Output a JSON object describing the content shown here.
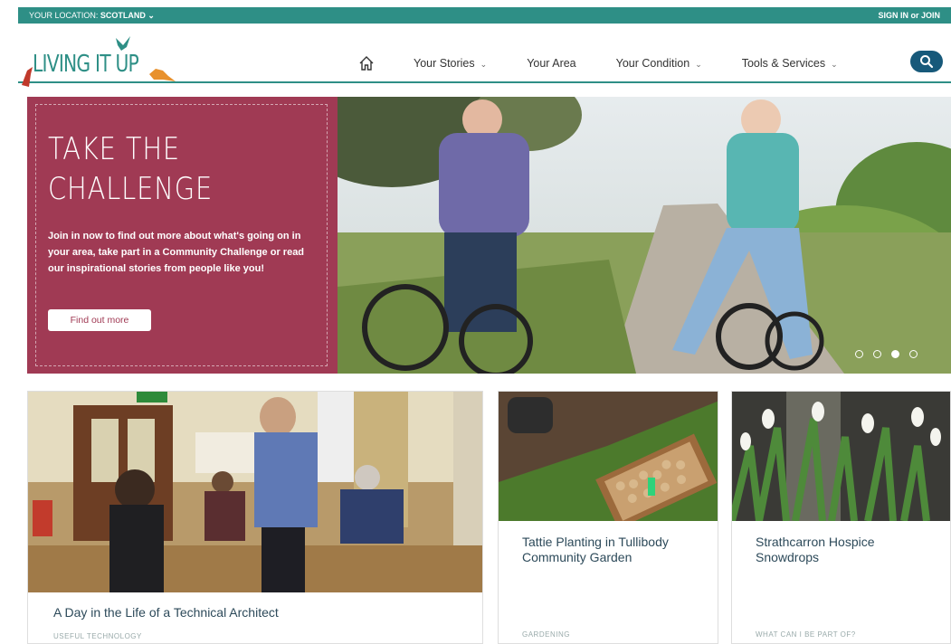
{
  "topbar": {
    "location_label": "YOUR LOCATION:",
    "location_value": "SCOTLAND",
    "location_chevron": "⌄",
    "signin": "SIGN IN or JOIN"
  },
  "header": {
    "logo_text": "LIVING IT UP",
    "nav": [
      {
        "label": "Your Stories",
        "has_dropdown": true
      },
      {
        "label": "Your Area",
        "has_dropdown": false
      },
      {
        "label": "Your Condition",
        "has_dropdown": true
      },
      {
        "label": "Tools & Services",
        "has_dropdown": true
      }
    ],
    "dropdown_glyph": "⌄"
  },
  "hero": {
    "title_line1": "TAKE THE",
    "title_line2": "CHALLENGE",
    "body": "Join in now to find out more about what's going on in your area, take part in a Community Challenge or read our inspirational stories from people like you!",
    "button_label": "Find out more",
    "slides": 4,
    "active_slide": 3
  },
  "cards": [
    {
      "title": "A Day in the Life of a Technical Architect",
      "category": "USEFUL TECHNOLOGY"
    },
    {
      "title": "Tattie Planting in Tullibody Community Garden",
      "category": "GARDENING"
    },
    {
      "title": "Strathcarron Hospice Snowdrops",
      "category": "WHAT CAN I BE PART OF?"
    }
  ],
  "colors": {
    "teal": "#2e8f86",
    "hero_panel": "#a03a54",
    "search": "#17597a",
    "card_title": "#2d4a5a"
  }
}
